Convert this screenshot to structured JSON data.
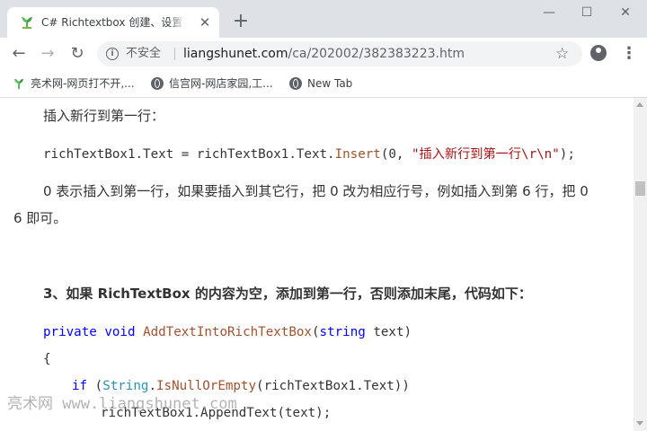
{
  "tab": {
    "title": "C# Richtextbox 创建、设置字体",
    "close_icon": "close-icon"
  },
  "window": {
    "minimize": "—",
    "maximize": "☐",
    "close": "✕"
  },
  "toolbar": {
    "back": "←",
    "forward": "→",
    "reload": "↻",
    "menu": "⋮"
  },
  "omnibox": {
    "security_label": "不安全",
    "url_host": "liangshunet.com",
    "url_path": "/ca/202002/382383223.htm"
  },
  "bookmarks": [
    {
      "label": "亮术网-网页打不开,..."
    },
    {
      "label": "信宫网-网店家园,工..."
    },
    {
      "label": "New Tab"
    }
  ],
  "article": {
    "p1": "插入新行到第一行：",
    "code1": {
      "a": "richTextBox1.Text = richTextBox1.Text.",
      "method": "Insert",
      "b": "(0, ",
      "str": "\"插入新行到第一行\\r\\n\"",
      "c": ");"
    },
    "p2a": "0 表示插入到第一行，如果要插入到其它行，把 0 改为相应行号，例如插入到第 6 行，把 0",
    "p2b": "6 即可。",
    "heading": "3、如果 RichTextBox 的内容为空，添加到第一行，否则添加末尾，代码如下：",
    "code2": {
      "kw1": "private",
      "kw2": "void",
      "method": "AddTextIntoRichTextBox",
      "open": "(",
      "kw3": "string",
      "param": " text)",
      "brace": "{",
      "if_kw": "if",
      "if_open": " (",
      "type": "String",
      "dot": ".",
      "if_method": "IsNullOrEmpty",
      "if_rest": "(richTextBox1.Text))",
      "append": "richTextBox1.AppendText(text);"
    }
  },
  "watermark": "亮术网 www.liangshunet.com"
}
